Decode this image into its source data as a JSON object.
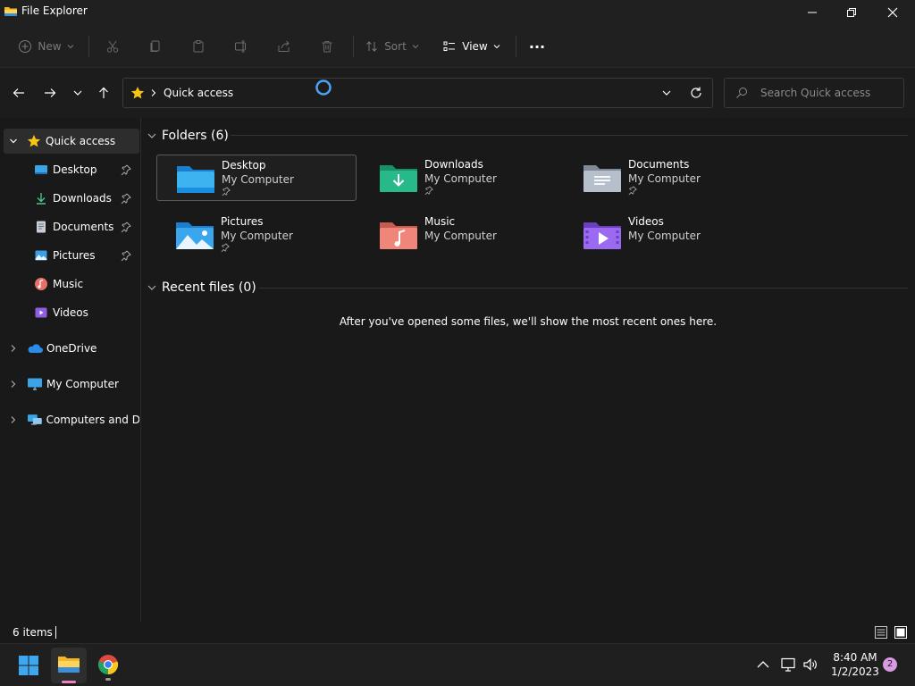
{
  "window": {
    "title": "File Explorer"
  },
  "toolbar": {
    "new_label": "New",
    "sort_label": "Sort",
    "view_label": "View",
    "more_label": "···"
  },
  "address": {
    "location": "Quick access"
  },
  "search": {
    "placeholder": "Search Quick access"
  },
  "sidebar": {
    "quick_access": "Quick access",
    "pinned": [
      {
        "label": "Desktop"
      },
      {
        "label": "Downloads"
      },
      {
        "label": "Documents"
      },
      {
        "label": "Pictures"
      },
      {
        "label": "Music"
      },
      {
        "label": "Videos"
      }
    ],
    "onedrive": "OneDrive",
    "my_computer": "My Computer",
    "network": "Computers and Dev"
  },
  "main": {
    "folders_header": "Folders (6)",
    "folders": [
      {
        "name": "Desktop",
        "location": "My Computer"
      },
      {
        "name": "Downloads",
        "location": "My Computer"
      },
      {
        "name": "Documents",
        "location": "My Computer"
      },
      {
        "name": "Pictures",
        "location": "My Computer"
      },
      {
        "name": "Music",
        "location": "My Computer"
      },
      {
        "name": "Videos",
        "location": "My Computer"
      }
    ],
    "recent_header": "Recent files (0)",
    "recent_empty": "After you've opened some files, we'll show the most recent ones here."
  },
  "status": {
    "items": "6 items"
  },
  "taskbar": {
    "time": "8:40 AM",
    "date": "1/2/2023",
    "notifications": "2"
  },
  "colors": {
    "accent": "#0078d4",
    "background": "#191919",
    "chrome": "#202020"
  }
}
